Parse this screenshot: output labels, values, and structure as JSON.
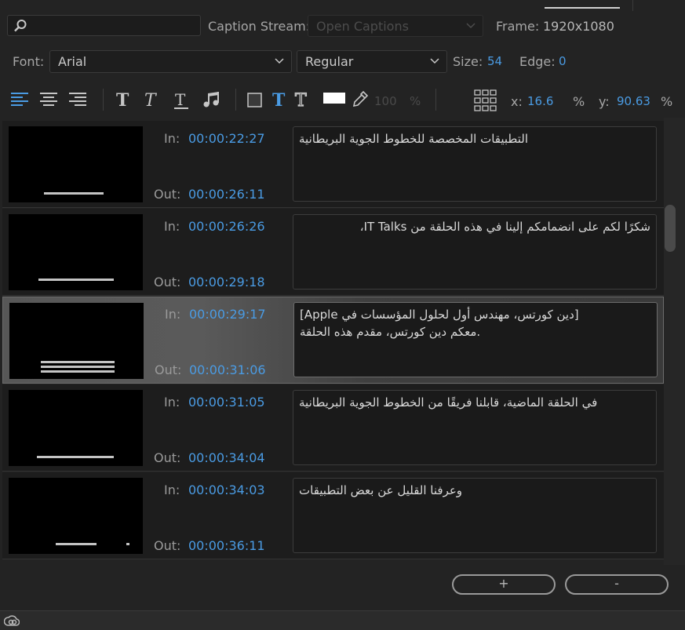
{
  "search": {
    "placeholder": "",
    "value": ""
  },
  "caption_stream": {
    "label": "Caption Stream:",
    "value": "Open Captions"
  },
  "frame": {
    "label": "Frame:",
    "value": "1920x1080"
  },
  "font": {
    "label": "Font:",
    "family": "Arial",
    "style": "Regular"
  },
  "size": {
    "label": "Size:",
    "value": "54"
  },
  "edge": {
    "label": "Edge:",
    "value": "0"
  },
  "opacity": {
    "value": "100",
    "unit": "%"
  },
  "position": {
    "x_label": "x:",
    "x_value": "16.6",
    "x_unit": "%",
    "y_label": "y:",
    "y_value": "90.63",
    "y_unit": "%"
  },
  "toolbar": {
    "icons": [
      "align-left-icon",
      "align-center-icon",
      "align-right-icon",
      "bold-icon",
      "italic-icon",
      "underline-icon",
      "music-note-icon",
      "background-box-icon",
      "text-color-icon",
      "edge-text-icon",
      "color-swatch-icon",
      "eyedropper-icon",
      "position-grid-icon"
    ],
    "swatch_color": "#ffffff"
  },
  "captions": [
    {
      "in_label": "In:",
      "in": "00:00:22:27",
      "out_label": "Out:",
      "out": "00:00:26:11",
      "text": "التطبيقات المخصصة للخطوط الجوية البريطانية",
      "selected": false
    },
    {
      "in_label": "In:",
      "in": "00:00:26:26",
      "out_label": "Out:",
      "out": "00:00:29:18",
      "text": "شكرًا لكم على انضمامكم إلينا في هذه الحلقة من IT Talks،",
      "selected": false
    },
    {
      "in_label": "In:",
      "in": "00:00:29:17",
      "out_label": "Out:",
      "out": "00:00:31:06",
      "text_line1": "[Apple دين كورتس، مهندس أول لحلول المؤسسات في]",
      "text_line2": "معكم دين كورتس، مقدم هذه الحلقة.",
      "selected": true
    },
    {
      "in_label": "In:",
      "in": "00:00:31:05",
      "out_label": "Out:",
      "out": "00:00:34:04",
      "text": "في الحلقة الماضية، قابلنا فريقًا من الخطوط الجوية البريطانية",
      "selected": false
    },
    {
      "in_label": "In:",
      "in": "00:00:34:03",
      "out_label": "Out:",
      "out": "00:00:36:11",
      "text": "وعرفنا القليل عن بعض التطبيقات",
      "selected": false
    }
  ],
  "buttons": {
    "add": "+",
    "remove": "-"
  },
  "colors": {
    "accent": "#4a9be3",
    "background": "#232323",
    "selected_row": "#5a5a5a"
  }
}
